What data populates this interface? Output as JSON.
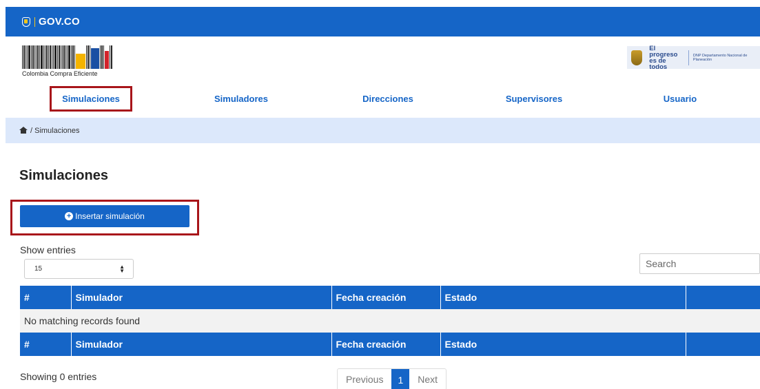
{
  "gov_bar": {
    "label": "GOV.CO"
  },
  "brand": {
    "cce_name": "Colombia Compra Eficiente",
    "progreso": "El progreso es de todos",
    "dnp": "DNP Departamento Nacional de Planeación"
  },
  "nav": {
    "items": [
      {
        "label": "Simulaciones",
        "active": true
      },
      {
        "label": "Simuladores"
      },
      {
        "label": "Direcciones"
      },
      {
        "label": "Supervisores"
      },
      {
        "label": "Usuario"
      }
    ]
  },
  "breadcrumb": {
    "text": "/ Simulaciones"
  },
  "page": {
    "title": "Simulaciones"
  },
  "actions": {
    "insert_label": "Insertar simulación"
  },
  "entries": {
    "label": "Show entries",
    "selected": "15"
  },
  "search": {
    "placeholder": "Search"
  },
  "table": {
    "columns": [
      "#",
      "Simulador",
      "Fecha creación",
      "Estado",
      ""
    ],
    "empty_message": "No matching records found"
  },
  "footer": {
    "showing": "Showing 0 entries",
    "previous": "Previous",
    "current_page": "1",
    "next": "Next"
  },
  "colors": {
    "primary": "#1565c7",
    "highlight": "#a8151a",
    "breadcrumb_bg": "#dce8fb"
  }
}
